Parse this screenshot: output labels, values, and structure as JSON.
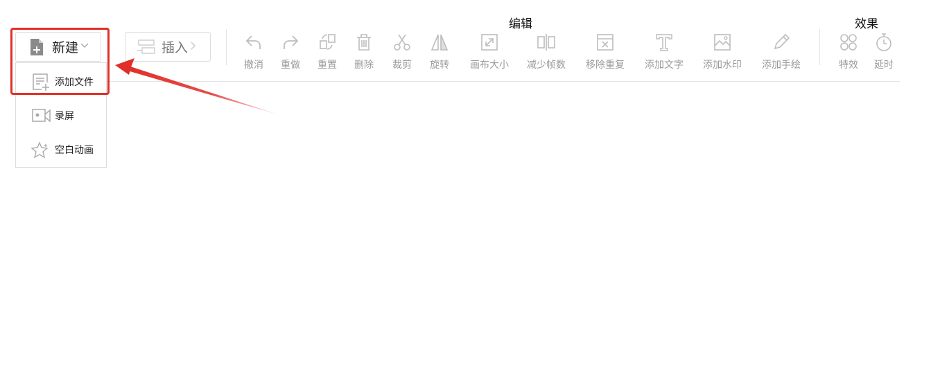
{
  "sections": {
    "edit_title": "编辑",
    "effects_title": "效果"
  },
  "buttons": {
    "new_label": "新建",
    "insert_label": "插入"
  },
  "new_menu": {
    "items": [
      {
        "label": "添加文件",
        "icon": "add-file-icon"
      },
      {
        "label": "录屏",
        "icon": "screen-record-icon"
      },
      {
        "label": "空白动画",
        "icon": "blank-animation-icon"
      }
    ]
  },
  "tools": [
    {
      "label": "撤消",
      "icon": "undo-icon"
    },
    {
      "label": "重做",
      "icon": "redo-icon"
    },
    {
      "label": "重置",
      "icon": "reset-icon"
    },
    {
      "label": "删除",
      "icon": "trash-icon"
    },
    {
      "label": "裁剪",
      "icon": "scissors-icon"
    },
    {
      "label": "旋转",
      "icon": "rotate-icon"
    },
    {
      "label": "画布大小",
      "icon": "canvas-size-icon"
    },
    {
      "label": "减少帧数",
      "icon": "reduce-frames-icon"
    },
    {
      "label": "移除重复",
      "icon": "remove-duplicates-icon"
    },
    {
      "label": "添加文字",
      "icon": "text-icon"
    },
    {
      "label": "添加水印",
      "icon": "watermark-icon"
    },
    {
      "label": "添加手绘",
      "icon": "pencil-icon"
    }
  ],
  "effect_tools": [
    {
      "label": "特效",
      "icon": "effects-icon"
    },
    {
      "label": "延时",
      "icon": "timer-icon"
    }
  ],
  "colors": {
    "highlight": "#e02f28",
    "icon_gray": "#bdbdbd",
    "label_gray": "#9a9a9a"
  }
}
